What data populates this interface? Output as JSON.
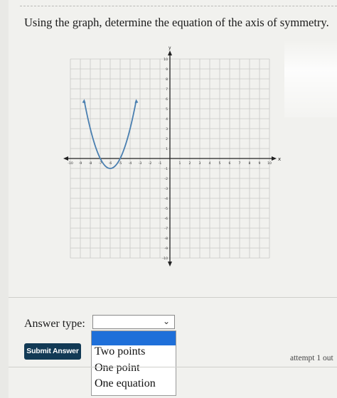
{
  "question": "Using the graph, determine the equation of the axis of symmetry.",
  "graph": {
    "x_label": "x",
    "y_label": "y",
    "x_ticks": [
      "-10",
      "-9",
      "-8",
      "-7",
      "-6",
      "-5",
      "-4",
      "-3",
      "-2",
      "-1",
      "1",
      "2",
      "3",
      "4",
      "5",
      "6",
      "7",
      "8",
      "9",
      "10"
    ],
    "y_ticks": [
      "10",
      "9",
      "8",
      "7",
      "6",
      "5",
      "4",
      "3",
      "2",
      "1",
      "-1",
      "-2",
      "-3",
      "-4",
      "-5",
      "-6",
      "-7",
      "-8",
      "-9",
      "-10"
    ],
    "range": [
      -10,
      10
    ],
    "parabola": {
      "vertex": [
        -6,
        -1
      ],
      "a": 1,
      "x_from": -8.6,
      "x_to": -3.4
    },
    "curve_color": "#4a7fb0"
  },
  "answer": {
    "label": "Answer type:",
    "selected": "",
    "options": [
      "",
      "Two points",
      "One point",
      "One equation"
    ]
  },
  "submit_label": "Submit Answer",
  "attempt_text": "attempt 1 out"
}
